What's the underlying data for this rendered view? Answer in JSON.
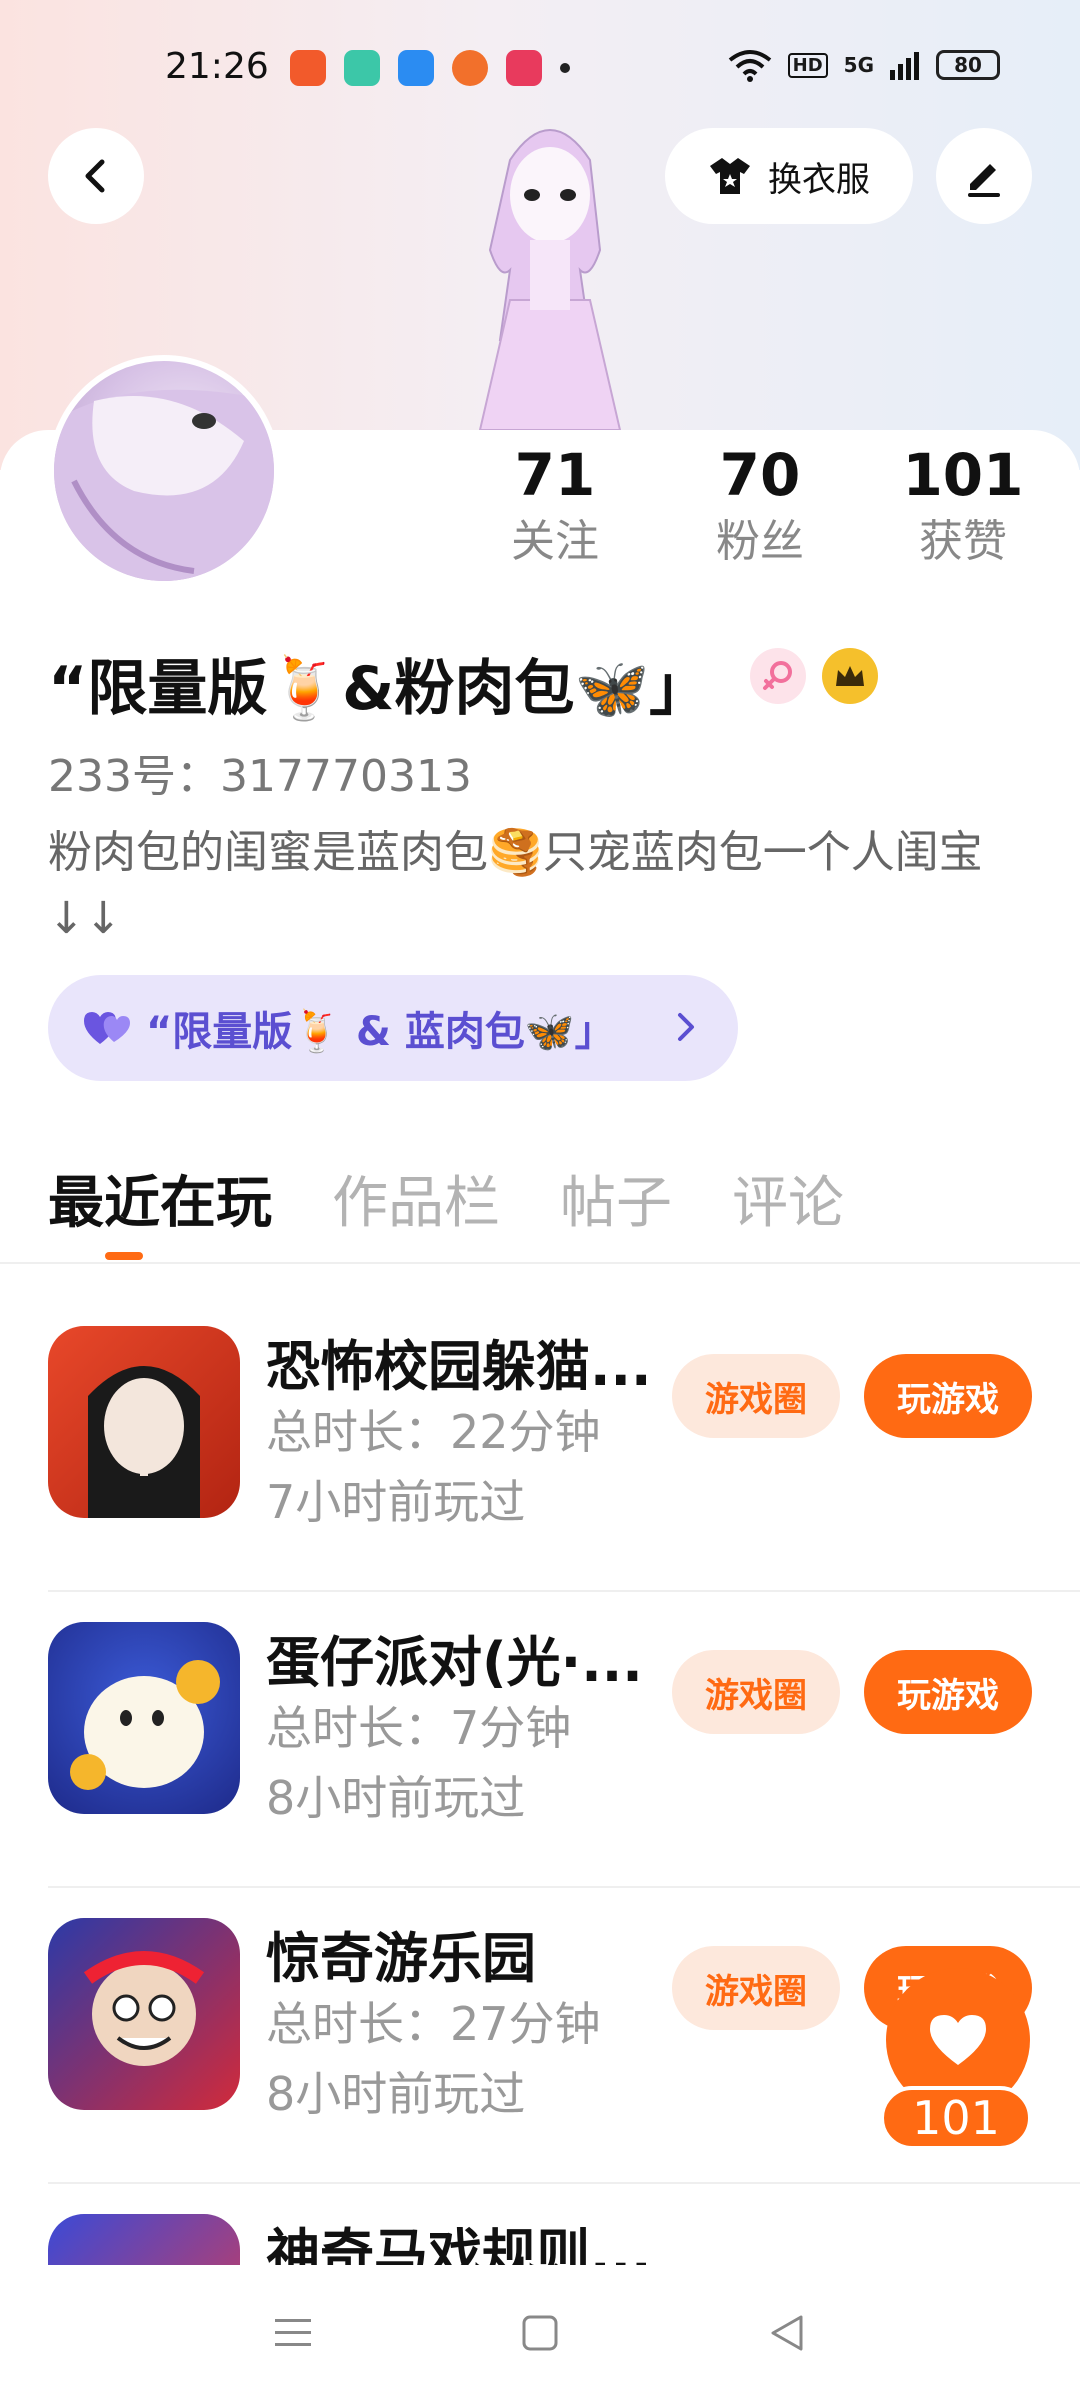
{
  "status_bar": {
    "time": "21:26",
    "network": "5G",
    "hd": "HD",
    "battery": "80"
  },
  "header": {
    "outfit_label": "换衣服"
  },
  "stats": [
    {
      "value": "71",
      "label": "关注"
    },
    {
      "value": "70",
      "label": "粉丝"
    },
    {
      "value": "101",
      "label": "获赞"
    }
  ],
  "profile": {
    "nickname": "“限量版🍹&粉肉包🦋」",
    "uid": "233号：317770313",
    "bio": "粉肉包的闺蜜是蓝肉包🥞只宠蓝肉包一个人闺宝↓↓",
    "partner": "“限量版🍹 & 蓝肉包🦋」"
  },
  "tabs": [
    "最近在玩",
    "作品栏",
    "帖子",
    "评论"
  ],
  "games": [
    {
      "name": "恐怖校园躲猫...",
      "duration": "总时长：22分钟",
      "last_played": "7小时前玩过",
      "circle_label": "游戏圈",
      "play_label": "玩游戏"
    },
    {
      "name": "蛋仔派对(光·...",
      "duration": "总时长：7分钟",
      "last_played": "8小时前玩过",
      "circle_label": "游戏圈",
      "play_label": "玩游戏"
    },
    {
      "name": "惊奇游乐园",
      "duration": "总时长：27分钟",
      "last_played": "8小时前玩过",
      "circle_label": "游戏圈",
      "play_label": "玩游戏"
    },
    {
      "name": "神奇马戏规则...",
      "duration": "",
      "last_played": "",
      "circle_label": "",
      "play_label": ""
    }
  ],
  "like_float": {
    "count": "101"
  },
  "colors": {
    "accent": "#ff6a13",
    "partner_bg": "#e9e5fb",
    "partner_text": "#5b4fd1",
    "tag_bg": "#fde8dc"
  },
  "icons": [
    "back-arrow-icon",
    "shirt-icon",
    "edit-pen-icon",
    "female-icon",
    "crown-icon",
    "heart-icon",
    "chevron-right-icon",
    "menu-icon",
    "home-square-icon",
    "back-triangle-icon"
  ]
}
